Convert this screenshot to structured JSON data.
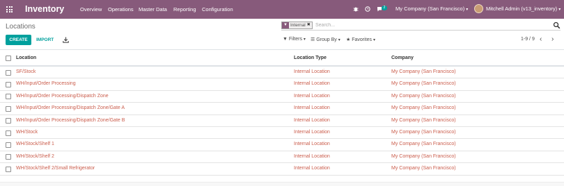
{
  "navbar": {
    "brand": "Inventory",
    "menu": [
      "Overview",
      "Operations",
      "Master Data",
      "Reporting",
      "Configuration"
    ],
    "messages_count": "2",
    "company": "My Company (San Francisco)",
    "user": "Mitchell Admin (v13_inventory)",
    "color": "#875a7b"
  },
  "control": {
    "breadcrumb": "Locations",
    "facet_label": "Internal",
    "search_placeholder": "Search...",
    "create_label": "CREATE",
    "import_label": "IMPORT",
    "filters_label": "Filters",
    "groupby_label": "Group By",
    "favorites_label": "Favorites",
    "pager": "1-9 / 9",
    "accent": "#00a09d"
  },
  "table": {
    "headers": [
      "Location",
      "Location Type",
      "Company"
    ],
    "rows": [
      [
        "SF/Stock",
        "Internal Location",
        "My Company (San Francisco)"
      ],
      [
        "WH/Input/Order Processing",
        "Internal Location",
        "My Company (San Francisco)"
      ],
      [
        "WH/Input/Order Processing/Dispatch Zone",
        "Internal Location",
        "My Company (San Francisco)"
      ],
      [
        "WH/Input/Order Processing/Dispatch Zone/Gate A",
        "Internal Location",
        "My Company (San Francisco)"
      ],
      [
        "WH/Input/Order Processing/Dispatch Zone/Gate B",
        "Internal Location",
        "My Company (San Francisco)"
      ],
      [
        "WH/Stock",
        "Internal Location",
        "My Company (San Francisco)"
      ],
      [
        "WH/Stock/Shelf 1",
        "Internal Location",
        "My Company (San Francisco)"
      ],
      [
        "WH/Stock/Shelf 2",
        "Internal Location",
        "My Company (San Francisco)"
      ],
      [
        "WH/Stock/Shelf 2/Small Refrigerator",
        "Internal Location",
        "My Company (San Francisco)"
      ]
    ],
    "link_color": "#ca5c4b"
  }
}
